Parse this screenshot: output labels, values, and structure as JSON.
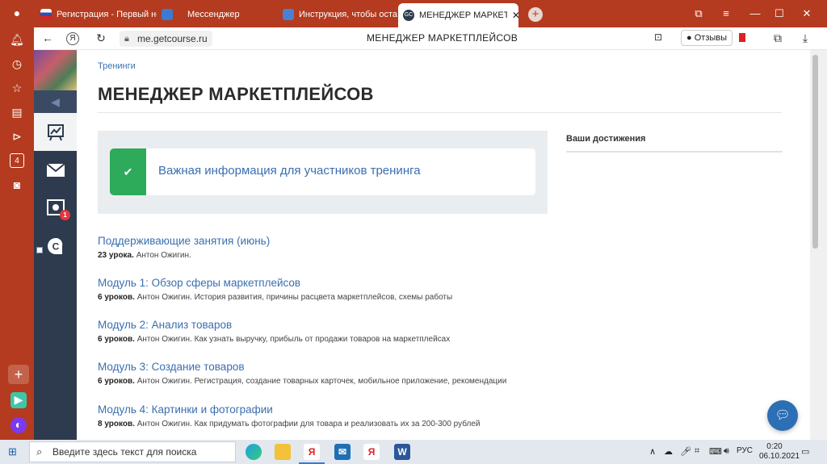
{
  "browser": {
    "tabs": [
      {
        "title": "Регистрация - Первый не",
        "favicon_color": "#ffffff"
      },
      {
        "title": "Мессенджер",
        "favicon_color": "#3b7bd5"
      },
      {
        "title": "Инструкция, чтобы остав",
        "favicon_color": "#4a7fd4"
      },
      {
        "title": "МЕНЕДЖЕР МАРКЕТПЛЕ",
        "favicon_color": "#2e3b4e",
        "favicon_text": "GC",
        "active": true
      }
    ],
    "url": "me.getcourse.ru",
    "page_title": "МЕНЕДЖЕР МАРКЕТПЛЕЙСОВ",
    "reviews_label": "Отзывы",
    "yandex_label": "Я",
    "sidebar_counter": "4",
    "accent_color": "#b43b1f"
  },
  "page": {
    "breadcrumb": "Тренинги",
    "title": "МЕНЕДЖЕР МАРКЕТПЛЕЙСОВ",
    "info_text": "Важная информация для участников тренинга",
    "achievements_label": "Ваши достижения",
    "sidebar_badge": "1",
    "lessons": [
      {
        "title": "Поддерживающие занятия (июнь)",
        "count": "23 урока.",
        "desc": "Антон Ожигин."
      },
      {
        "title": "Модуль 1: Обзор сферы маркетплейсов",
        "count": "6 уроков.",
        "desc": "Антон Ожигин. История развития, причины расцвета маркетплейсов, схемы работы"
      },
      {
        "title": "Модуль 2: Анализ товаров",
        "count": "6 уроков.",
        "desc": "Антон Ожигин. Как узнать выручку, прибыль от продажи товаров на маркетплейсах"
      },
      {
        "title": "Модуль 3: Создание товаров",
        "count": "6 уроков.",
        "desc": "Антон Ожигин. Регистрация, создание товарных карточек, мобильное приложение, рекомендации"
      },
      {
        "title": "Модуль 4: Картинки и фотографии",
        "count": "8 уроков.",
        "desc": "Антон Ожигин. Как придумать фотографии для товара и реализовать их за 200-300 рублей"
      }
    ]
  },
  "taskbar": {
    "search_placeholder": "Введите здесь текст для поиска",
    "lang": "РУС",
    "time": "0:20",
    "date": "06.10.2021",
    "yandex_label": "Я",
    "word_label": "W"
  }
}
